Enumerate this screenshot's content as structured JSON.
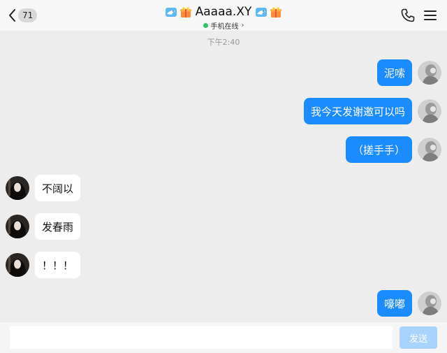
{
  "header": {
    "back_icon": "chevron-left-icon",
    "unread_count": "71",
    "title": "Aaaaa.XY",
    "status_text": "手机在线",
    "status_chevron": "›",
    "status_color": "#33c36b",
    "badges": [
      "dolphin-badge-icon",
      "gift-badge-icon"
    ],
    "phone_icon": "phone-icon",
    "menu_icon": "menu-icon"
  },
  "chat": {
    "timestamp": "下午2:40",
    "messages": [
      {
        "direction": "out",
        "text": "泥嗦"
      },
      {
        "direction": "out",
        "text": "我今天发谢邀可以吗"
      },
      {
        "direction": "out",
        "text": "（搓手手）"
      },
      {
        "direction": "in",
        "text": "不阔以"
      },
      {
        "direction": "in",
        "text": "发春雨"
      },
      {
        "direction": "in",
        "text": "！！！"
      },
      {
        "direction": "out",
        "text": "嚎嘟"
      }
    ]
  },
  "input_bar": {
    "placeholder": "",
    "value": "",
    "send_label": "发送"
  },
  "colors": {
    "outgoing_bubble": "#1a8cff",
    "incoming_bubble": "#ffffff",
    "background": "#ededed",
    "send_button": "#a8d3ff"
  }
}
